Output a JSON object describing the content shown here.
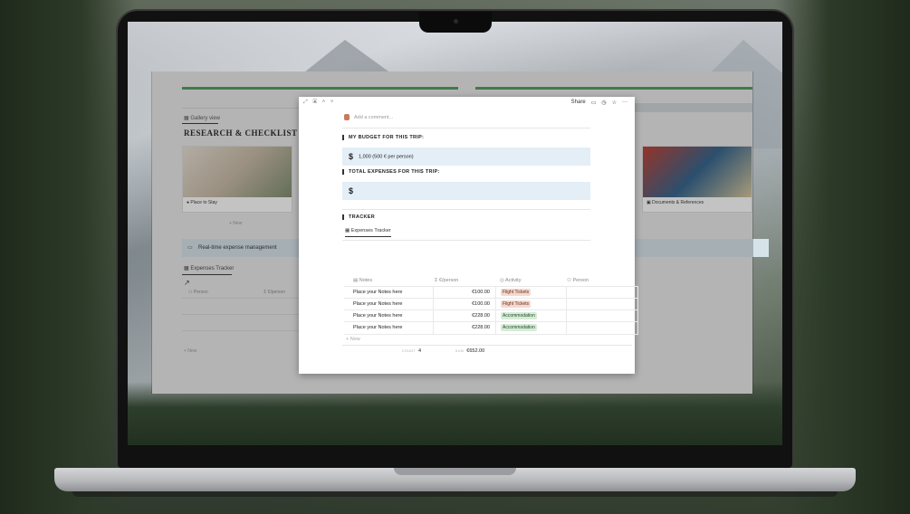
{
  "background_page": {
    "gallery_view_label": "Gallery view",
    "title": "RESEARCH & CHECKLIST",
    "cards": [
      {
        "caption": "Place to Stay"
      },
      {
        "caption": "Documents & References"
      }
    ],
    "new_label": "+ New",
    "callout": "Real-time expense management",
    "tracker_tab": "Expenses Tracker",
    "columns": [
      "Person",
      "€/person"
    ],
    "new_row": "+ New"
  },
  "modal": {
    "topbar": {
      "share_label": "Share"
    },
    "add_comment": "Add a comment...",
    "budget_heading": "MY BUDGET FOR THIS TRIP:",
    "budget_value": "1,000 (500 € per person)",
    "dollar_symbol": "$",
    "expenses_heading": "TOTAL EXPENSES FOR THIS TRIP:",
    "expenses_value": "",
    "tracker_heading": "TRACKER",
    "tracker_tab": "Expenses Tracker",
    "table": {
      "headers": [
        "Notes",
        "€/person",
        "Activity",
        "Person"
      ],
      "rows": [
        {
          "notes": "Place your Notes here",
          "eur": "€100.00",
          "activity": "Flight Tickets",
          "activity_type": "flight"
        },
        {
          "notes": "Place your Notes here",
          "eur": "€100.00",
          "activity": "Flight Tickets",
          "activity_type": "flight"
        },
        {
          "notes": "Place your Notes here",
          "eur": "€228.00",
          "activity": "Accommodation",
          "activity_type": "accom"
        },
        {
          "notes": "Place your Notes here",
          "eur": "€228.00",
          "activity": "Accommodation",
          "activity_type": "accom"
        }
      ],
      "new_row": "+ New",
      "count_label": "COUNT",
      "count_value": "4",
      "sum_label": "SUM",
      "sum_value": "€652.00"
    }
  },
  "colors": {
    "accent_green": "#4a9a5a",
    "money_box_bg": "#e3eef6",
    "flight_tag_bg": "#f4d9cf",
    "accommodation_tag_bg": "#d6ecd8"
  }
}
